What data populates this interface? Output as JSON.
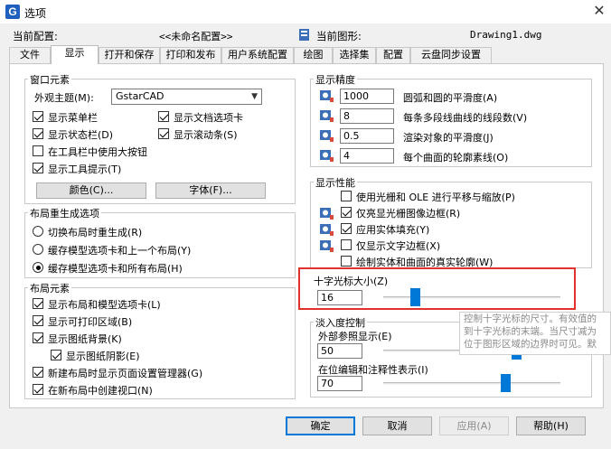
{
  "window": {
    "title": "选项",
    "close_glyph": "✕"
  },
  "header": {
    "current_config_label": "当前配置:",
    "current_config_value": "<<未命名配置>>",
    "current_drawing_label": "当前图形:",
    "current_drawing_value": "Drawing1.dwg"
  },
  "tabs": [
    "文件",
    "显示",
    "打开和保存",
    "打印和发布",
    "用户系统配置",
    "绘图",
    "选择集",
    "配置",
    "云盘同步设置"
  ],
  "active_tab": "显示",
  "window_elements": {
    "title": "窗口元素",
    "theme_label": "外观主题(M):",
    "theme_value": "GstarCAD",
    "checkboxes": [
      {
        "label": "显示菜单栏",
        "checked": true
      },
      {
        "label": "显示文档选项卡",
        "checked": true
      },
      {
        "label": "显示状态栏(D)",
        "checked": true
      },
      {
        "label": "显示滚动条(S)",
        "checked": true
      },
      {
        "label": "在工具栏中使用大按钮",
        "checked": false
      },
      {
        "label": "显示工具提示(T)",
        "checked": true
      }
    ],
    "color_button": "颜色(C)...",
    "font_button": "字体(F)..."
  },
  "layout_regen": {
    "title": "布局重生成选项",
    "radios": [
      {
        "label": "切换布局时重生成(R)",
        "checked": false
      },
      {
        "label": "缓存模型选项卡和上一个布局(Y)",
        "checked": false
      },
      {
        "label": "缓存模型选项卡和所有布局(H)",
        "checked": true
      }
    ]
  },
  "layout_elements": {
    "title": "布局元素",
    "checkboxes": [
      {
        "label": "显示布局和模型选项卡(L)",
        "checked": true
      },
      {
        "label": "显示可打印区域(B)",
        "checked": true
      },
      {
        "label": "显示图纸背景(K)",
        "checked": true
      },
      {
        "label": "显示图纸阴影(E)",
        "checked": true
      },
      {
        "label": "新建布局时显示页面设置管理器(G)",
        "checked": true
      },
      {
        "label": "在新布局中创建视口(N)",
        "checked": true
      }
    ]
  },
  "display_resolution": {
    "title": "显示精度",
    "rows": [
      {
        "value": "1000",
        "label": "圆弧和圆的平滑度(A)"
      },
      {
        "value": "8",
        "label": "每条多段线曲线的线段数(V)"
      },
      {
        "value": "0.5",
        "label": "渲染对象的平滑度(J)"
      },
      {
        "value": "4",
        "label": "每个曲面的轮廓素线(O)"
      }
    ]
  },
  "display_performance": {
    "title": "显示性能",
    "checkboxes": [
      {
        "label": "使用光栅和 OLE 进行平移与缩放(P)",
        "checked": false,
        "icon": false
      },
      {
        "label": "仅亮显光栅图像边框(R)",
        "checked": true,
        "icon": true
      },
      {
        "label": "应用实体填充(Y)",
        "checked": true,
        "icon": true
      },
      {
        "label": "仅显示文字边框(X)",
        "checked": false,
        "icon": true
      },
      {
        "label": "绘制实体和曲面的真实轮廓(W)",
        "checked": false,
        "icon": false
      }
    ]
  },
  "crosshair": {
    "title": "十字光标大小(Z)",
    "value": "16",
    "slider_fraction": 0.16
  },
  "fade_control": {
    "title": "淡入度控制",
    "xref_label": "外部参照显示(E)",
    "xref_value": "50",
    "inplace_label": "在位编辑和注释性表示(I)",
    "inplace_value": "70",
    "inplace_fraction": 0.7
  },
  "tooltip": {
    "lines": [
      "控制十字光标的尺寸。有效值的",
      "到十字光标的末端。当尺寸减为",
      "位于图形区域的边界时可见。默"
    ]
  },
  "footer": {
    "ok": "确定",
    "cancel": "取消",
    "apply": "应用(A)",
    "help": "帮助(H)"
  },
  "colors": {
    "accent": "#0078d7",
    "highlight": "#e0312c",
    "app_icon": "#1e5fbf"
  }
}
